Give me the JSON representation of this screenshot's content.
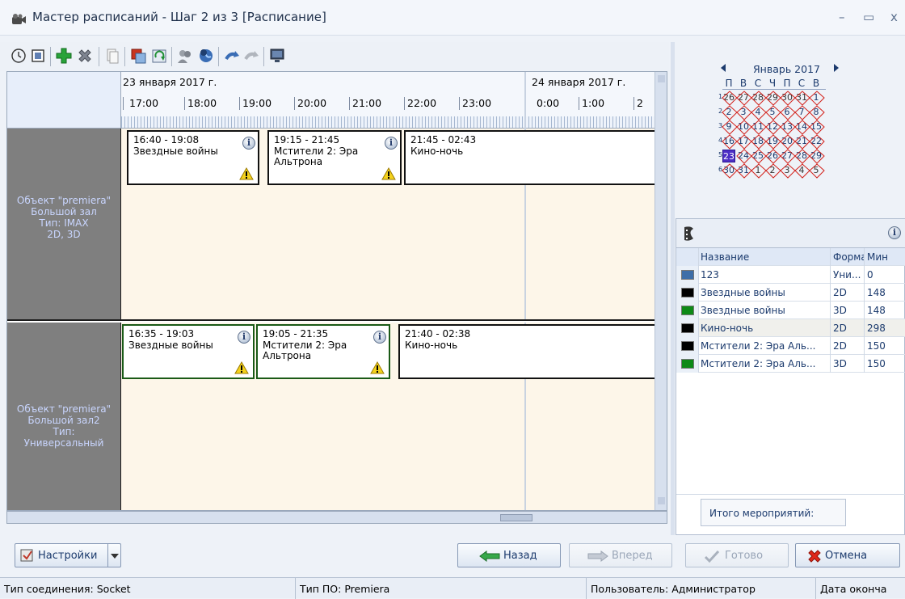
{
  "window": {
    "title": "Мастер расписаний - Шаг 2 из 3 [Расписание]",
    "minimize": "–",
    "maximize": "▭",
    "close": "x"
  },
  "toolbar": {
    "icons": [
      "clock-icon",
      "select-icon",
      "add-icon",
      "delete-icon",
      "copy-icon",
      "export-icon",
      "refresh-icon",
      "users-icon",
      "globe-icon",
      "undo-icon",
      "redo-icon",
      "monitor-icon"
    ]
  },
  "timeline": {
    "dates": [
      "23 января 2017 г.",
      "24 января 2017 г."
    ],
    "hours": [
      "17:00",
      "18:00",
      "19:00",
      "20:00",
      "21:00",
      "22:00",
      "23:00",
      "0:00",
      "1:00",
      "2"
    ]
  },
  "halls": [
    {
      "label": "Объект \"premiera\"\nБольшой зал\nТип: IMAX\n2D, 3D",
      "events": [
        {
          "time": "16:40 - 19:08",
          "name": "Звездные войны",
          "info": "i",
          "warning": true
        },
        {
          "time": "19:15 - 21:45",
          "name": "Мстители 2: Эра\nАльтрона",
          "info": "i",
          "warning": true
        },
        {
          "time": "21:45 - 02:43",
          "name": "Кино-ночь",
          "warning": false
        }
      ]
    },
    {
      "label": "Объект \"premiera\"\nБольшой зал2\nТип:\nУниверсальный",
      "events": [
        {
          "time": "16:35 - 19:03",
          "name": "Звездные войны",
          "info": "i",
          "warning": true
        },
        {
          "time": "19:05 - 21:35",
          "name": "Мстители 2: Эра\nАльтрона",
          "info": "i",
          "warning": true
        },
        {
          "time": "21:40 - 02:38",
          "name": "Кино-ночь",
          "warning": false
        }
      ]
    }
  ],
  "calendar": {
    "month": "Январь 2017",
    "dow": [
      "П",
      "В",
      "С",
      "Ч",
      "П",
      "С",
      "В"
    ],
    "weeks": [
      {
        "n": "1",
        "days": [
          "26",
          "27",
          "28",
          "29",
          "30",
          "31",
          "1"
        ]
      },
      {
        "n": "2",
        "days": [
          "2",
          "3",
          "4",
          "5",
          "6",
          "7",
          "8"
        ]
      },
      {
        "n": "3",
        "days": [
          "9",
          "10",
          "11",
          "12",
          "13",
          "14",
          "15"
        ]
      },
      {
        "n": "4",
        "days": [
          "16",
          "17",
          "18",
          "19",
          "20",
          "21",
          "22"
        ]
      },
      {
        "n": "5",
        "days": [
          "23",
          "24",
          "25",
          "26",
          "27",
          "28",
          "29"
        ]
      },
      {
        "n": "6",
        "days": [
          "30",
          "31",
          "1",
          "2",
          "3",
          "4",
          "5"
        ]
      }
    ],
    "selected": "23"
  },
  "films": {
    "info": "i",
    "columns": [
      "Название",
      "Форма",
      "Мин"
    ],
    "rows": [
      {
        "color": "#3e6ea8",
        "name": "123",
        "format": "Уни...",
        "min": "0"
      },
      {
        "color": "#000000",
        "name": "Звездные войны",
        "format": "2D",
        "min": "148"
      },
      {
        "color": "#0e8a17",
        "name": "Звездные войны",
        "format": "3D",
        "min": "148"
      },
      {
        "color": "#000000",
        "name": "Кино-ночь",
        "format": "2D",
        "min": "298"
      },
      {
        "color": "#000000",
        "name": "Мстители 2: Эра Аль...",
        "format": "2D",
        "min": "150"
      },
      {
        "color": "#0e8a17",
        "name": "Мстители 2: Эра Аль...",
        "format": "3D",
        "min": "150"
      }
    ],
    "total_label": "Итого мероприятий:"
  },
  "buttons": {
    "settings": "Настройки",
    "back": "Назад",
    "forward": "Вперед",
    "done": "Готово",
    "cancel": "Отмена"
  },
  "status": {
    "connection": "Тип соединения: Socket",
    "software": "Тип ПО: Premiera",
    "user": "Пользователь: Администратор",
    "end_date": "Дата оконча"
  }
}
